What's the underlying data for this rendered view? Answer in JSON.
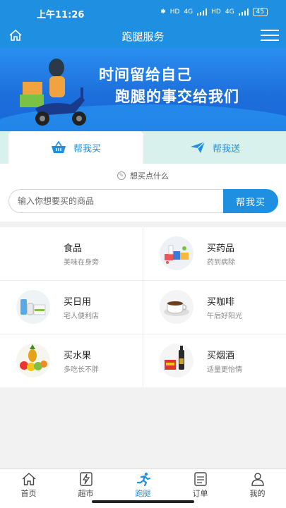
{
  "status": {
    "time": "上午11:26",
    "hd1": "HD",
    "net1": "4G",
    "hd2": "HD",
    "net2": "4G",
    "battery": "45"
  },
  "header": {
    "title": "跑腿服务"
  },
  "banner": {
    "line1": "时间留给自己",
    "line2": "跑腿的事交给我们"
  },
  "tabs": {
    "buy": "帮我买",
    "send": "帮我送"
  },
  "search": {
    "hint": "想买点什么",
    "placeholder": "输入你想要买的商品",
    "button": "帮我买"
  },
  "categories": [
    {
      "name": "食品",
      "desc": "美味在身旁"
    },
    {
      "name": "买药品",
      "desc": "药到病除"
    },
    {
      "name": "买日用",
      "desc": "宅人便利店"
    },
    {
      "name": "买咖啡",
      "desc": "午后好阳光"
    },
    {
      "name": "买水果",
      "desc": "多吃长不胖"
    },
    {
      "name": "买烟酒",
      "desc": "适量更怡情"
    }
  ],
  "nav": [
    {
      "label": "首页",
      "icon": "home-icon"
    },
    {
      "label": "超市",
      "icon": "lightning-icon"
    },
    {
      "label": "跑腿",
      "icon": "runner-icon"
    },
    {
      "label": "订单",
      "icon": "list-icon"
    },
    {
      "label": "我的",
      "icon": "user-icon"
    }
  ],
  "colors": {
    "primary": "#1e8fe1",
    "tab_bg": "#d8f1ec"
  }
}
